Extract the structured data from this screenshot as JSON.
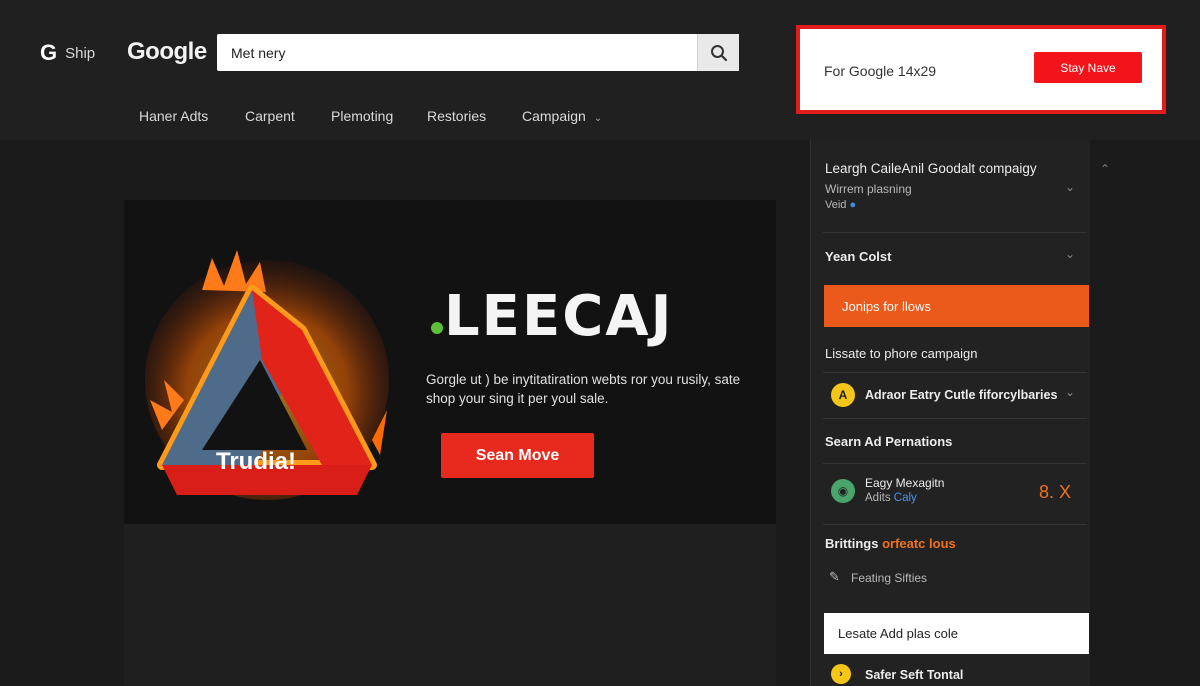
{
  "header": {
    "brand_icon": "G",
    "brand_text": "Ship",
    "logo_text": "Google",
    "search": {
      "value": "Met nery",
      "icon": "search-icon"
    },
    "promo": {
      "text": "For Google 14x29",
      "button": "Stay Nave",
      "border_color": "#e21b1b"
    },
    "nav": [
      "Haner Adts",
      "Carpent",
      "Plemoting",
      "Restories",
      "Campaign"
    ]
  },
  "hero": {
    "caption": "Trudia!",
    "title": "LEECAJ",
    "description": "Gorgle ut ) be inytitatiration webts ror you rusily, sate shop your sing it per youl sale.",
    "button": "Sean Move",
    "accent": "#e8291d"
  },
  "sidebar": {
    "campaign": {
      "title": "Leargh CaileAnil Goodalt compaigy",
      "sub": "Wirrem plasning",
      "meta": "Veid"
    },
    "team": "Yean Colst",
    "orange_button": "Jonips for llows",
    "lissate": "Lissate to phore campaign",
    "adraor": {
      "icon": "A",
      "label": "Adraor Eatry Cutle fiforcylbaries"
    },
    "search_ads": "Searn Ad Pernations",
    "easy": {
      "title": "Eagy Mexagitn",
      "sub_prefix": "Adits ",
      "sub_link": "Caly",
      "stat": "8. X"
    },
    "brittings": {
      "prefix": "Brittings ",
      "highlight": "orfeatc lous"
    },
    "feating": "Feating Sifties",
    "white_bar": "Lesate Add plas cole",
    "safer": "Safer Seft Tontal",
    "accent": "#eb5a1b"
  }
}
